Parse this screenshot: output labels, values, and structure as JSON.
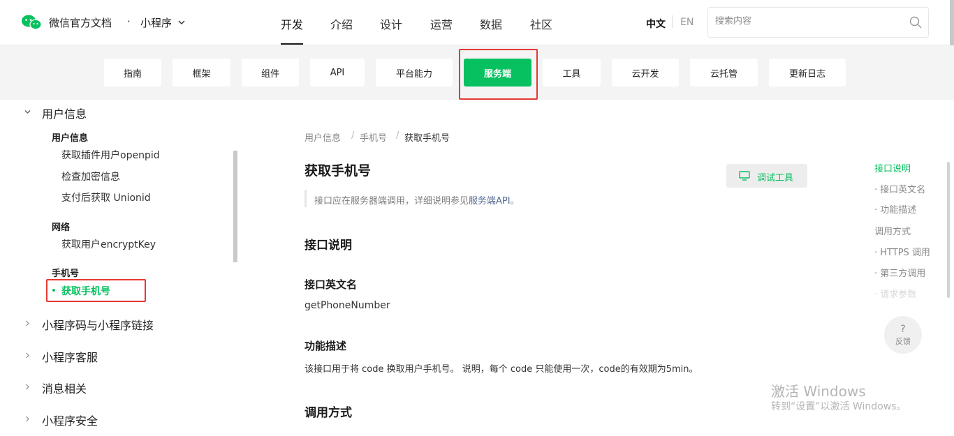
{
  "header": {
    "brand": "微信官方文档",
    "brand_dot": "·",
    "brand_sub": "小程序",
    "nav": [
      "开发",
      "介绍",
      "设计",
      "运营",
      "数据",
      "社区"
    ],
    "lang_zh": "中文",
    "lang_en": "EN",
    "search_placeholder": "搜索内容"
  },
  "subnav": {
    "chips": [
      "指南",
      "框架",
      "组件",
      "API",
      "平台能力",
      "服务端",
      "工具",
      "云开发",
      "云托管",
      "更新日志"
    ],
    "active": "服务端"
  },
  "sidebar": {
    "section_user": "用户信息",
    "group_user": "用户信息",
    "link_openpid": "获取插件用户openpid",
    "link_check": "检查加密信息",
    "link_unionid": "支付后获取 Unionid",
    "group_net": "网络",
    "link_encrypt": "获取用户encryptKey",
    "group_phone": "手机号",
    "link_phone": "获取手机号",
    "section_qrcode": "小程序码与小程序链接",
    "section_service": "小程序客服",
    "section_msg": "消息相关",
    "section_security": "小程序安全"
  },
  "breadcrumb": [
    "用户信息",
    "手机号",
    "获取手机号"
  ],
  "main": {
    "title": "获取手机号",
    "debug_button": "调试工具",
    "note_prefix": "接口应在服务器端调用，详细说明参见",
    "note_link": "服务端API",
    "note_suffix": "。",
    "h_desc": "接口说明",
    "h_name": "接口英文名",
    "api_name": "getPhoneNumber",
    "h_func": "功能描述",
    "func_text": "该接口用于将 code 换取用户手机号。 说明，每个 code 只能使用一次，code的有效期为5min。",
    "h_call": "调用方式"
  },
  "toc": [
    "接口说明",
    "· 接口英文名",
    "· 功能描述",
    "调用方式",
    "· HTTPS 调用",
    "· 第三方调用",
    "· 请求参数"
  ],
  "feedback": {
    "icon": "?",
    "label": "反馈"
  },
  "watermark": {
    "line1": "激活 Windows",
    "line2": "转到“设置”以激活 Windows。"
  },
  "colors": {
    "accent": "#07c160",
    "highlight": "#e53935",
    "link": "#576b95"
  }
}
